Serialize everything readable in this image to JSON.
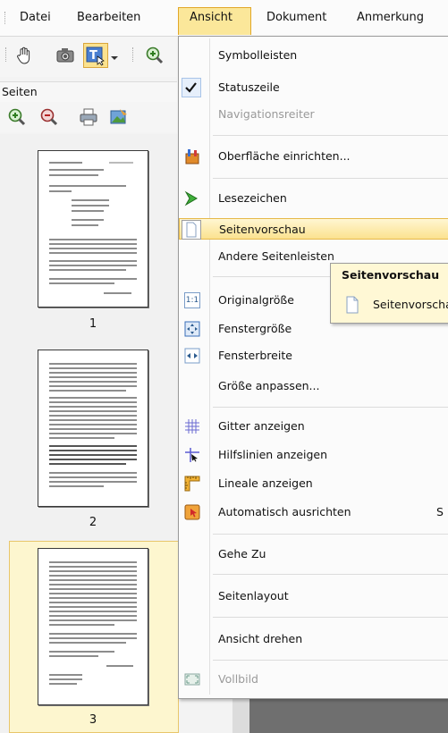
{
  "menubar": {
    "items": [
      {
        "label": "Datei"
      },
      {
        "label": "Bearbeiten"
      },
      {
        "label": "Ansicht"
      },
      {
        "label": "Dokument"
      },
      {
        "label": "Anmerkung"
      }
    ]
  },
  "left_panel": {
    "title": "Seiten",
    "pages": [
      {
        "number": "1"
      },
      {
        "number": "2"
      },
      {
        "number": "3"
      }
    ],
    "selected_page": "3"
  },
  "view_menu": {
    "items": [
      {
        "label": "Symbolleisten",
        "icon": "none"
      },
      {
        "label": "Statuszeile",
        "icon": "checkmark-icon",
        "checked": true
      },
      {
        "label": "Navigationsreiter",
        "disabled": true
      },
      {
        "label": "Oberfläche einrichten...",
        "icon": "customize-ui-icon"
      },
      {
        "label": "Lesezeichen",
        "icon": "bookmark-icon"
      },
      {
        "label": "Seitenvorschau",
        "icon": "page-preview-icon",
        "highlighted": true
      },
      {
        "label": "Andere Seitenleisten"
      },
      {
        "label": "Originalgröße",
        "icon": "actual-size-icon"
      },
      {
        "label": "Fenstergröße",
        "icon": "fit-window-icon"
      },
      {
        "label": "Fensterbreite",
        "icon": "fit-width-icon"
      },
      {
        "label": "Größe anpassen..."
      },
      {
        "label": "Gitter anzeigen",
        "icon": "grid-icon"
      },
      {
        "label": "Hilfslinien anzeigen",
        "icon": "guides-icon"
      },
      {
        "label": "Lineale anzeigen",
        "icon": "ruler-icon"
      },
      {
        "label": "Automatisch ausrichten",
        "icon": "snap-icon",
        "accelerator_partial": "S"
      },
      {
        "label": "Gehe Zu"
      },
      {
        "label": "Seitenlayout"
      },
      {
        "label": "Ansicht drehen"
      },
      {
        "label": "Vollbild",
        "icon": "fullscreen-icon",
        "disabled": true
      }
    ]
  },
  "tooltip": {
    "title": "Seitenvorschau",
    "body": "Seitenvorschau"
  },
  "colors": {
    "highlight": "#fbe28f",
    "highlight_border": "#e6b94a",
    "tooltip_bg": "#fff8d5",
    "disabled_text": "#9a9a9a"
  }
}
